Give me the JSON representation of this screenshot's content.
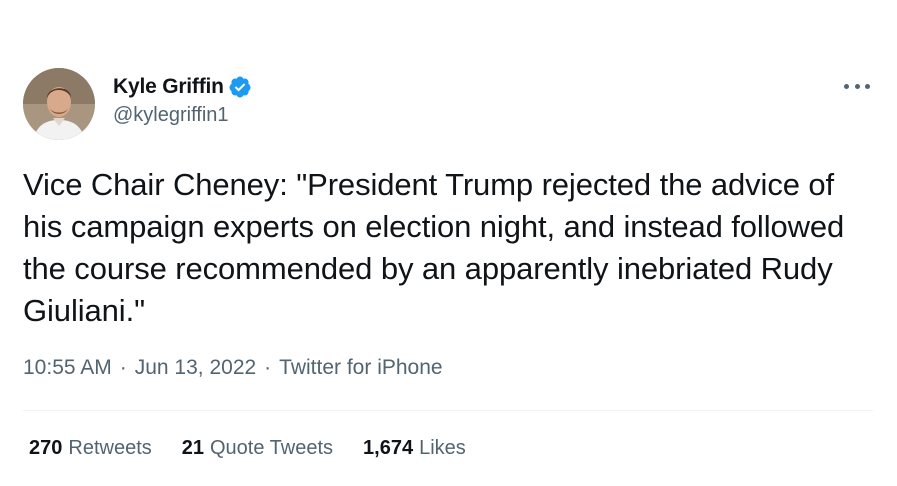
{
  "author": {
    "display_name": "Kyle Griffin",
    "handle": "@kylegriffin1",
    "verified": true
  },
  "tweet": {
    "text": "Vice Chair Cheney: \"President Trump rejected the advice of his campaign experts on election night, and instead followed the course recommended by an apparently inebriated Rudy Giuliani.\"",
    "time": "10:55 AM",
    "date": "Jun 13, 2022",
    "source": "Twitter for iPhone",
    "separator": "·"
  },
  "stats": {
    "retweets": {
      "count": "270",
      "label": "Retweets"
    },
    "quote_tweets": {
      "count": "21",
      "label": "Quote Tweets"
    },
    "likes": {
      "count": "1,674",
      "label": "Likes"
    }
  },
  "icons": {
    "verified": "verified-badge-icon",
    "more": "more-options-icon"
  },
  "colors": {
    "primary_text": "#0f1419",
    "secondary_text": "#536471",
    "verified_blue": "#1d9bf0",
    "divider": "#eff3f4"
  }
}
